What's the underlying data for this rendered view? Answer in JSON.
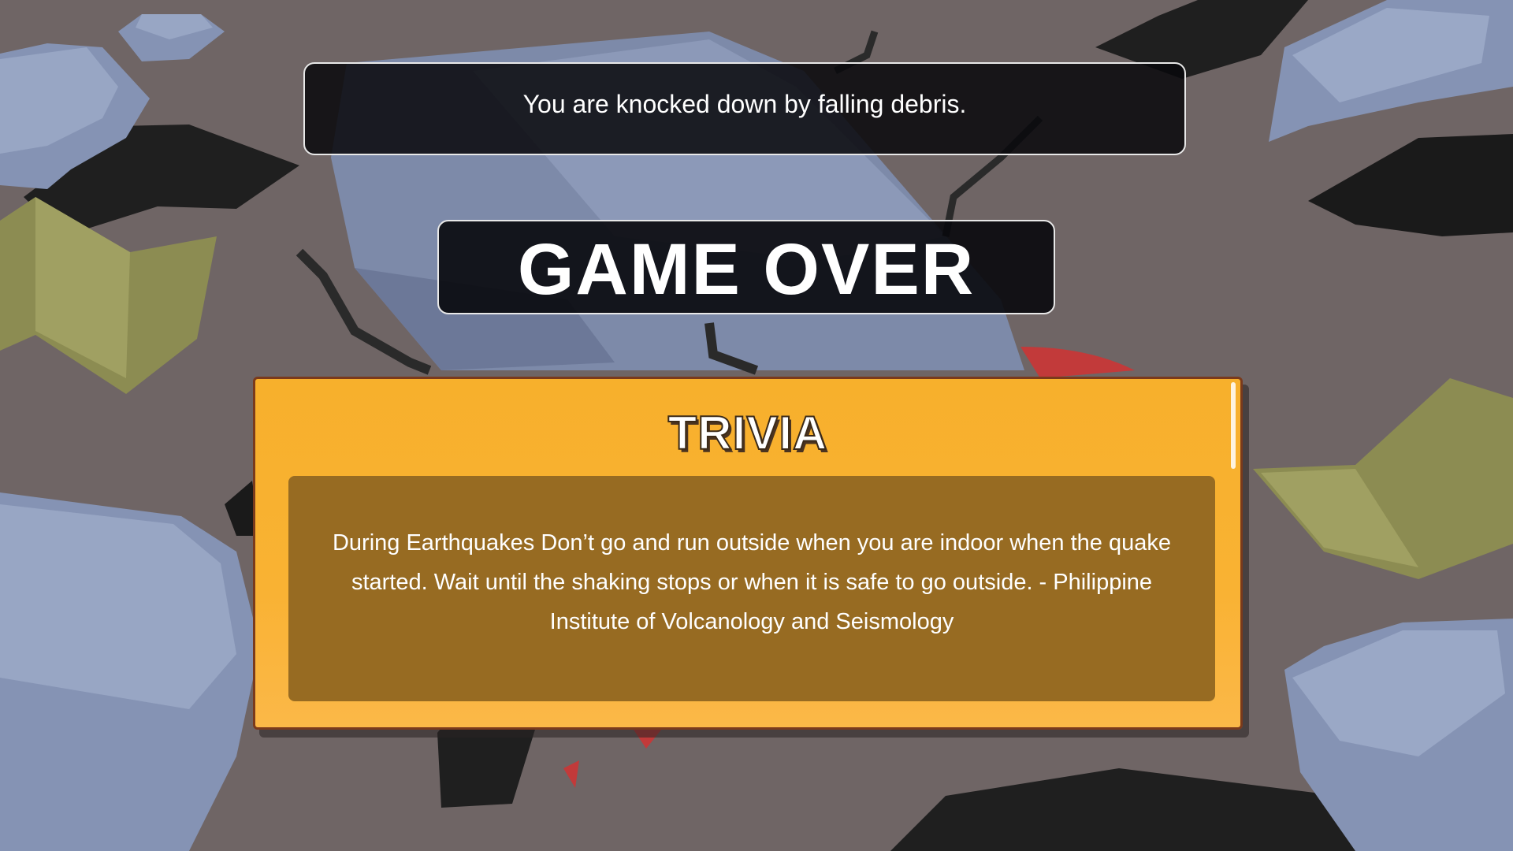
{
  "message": {
    "text": "You are knocked down by falling debris."
  },
  "game_over": {
    "title": "GAME OVER"
  },
  "trivia": {
    "heading": "TRIVIA",
    "body": "During Earthquakes Don’t go and run outside when you are indoor when the quake started. Wait until the shaking stops or when it is safe to go outside. - Philippine Institute of Volcanology and Seismology"
  },
  "colors": {
    "background": "#6f6565",
    "rock": "#8593b4",
    "rubble_dark": "#1f1f1f",
    "debris_olive": "#9a9a5e",
    "blood": "#c23a3a",
    "trivia_card": "#f9b233",
    "trivia_panel": "#976b22"
  }
}
